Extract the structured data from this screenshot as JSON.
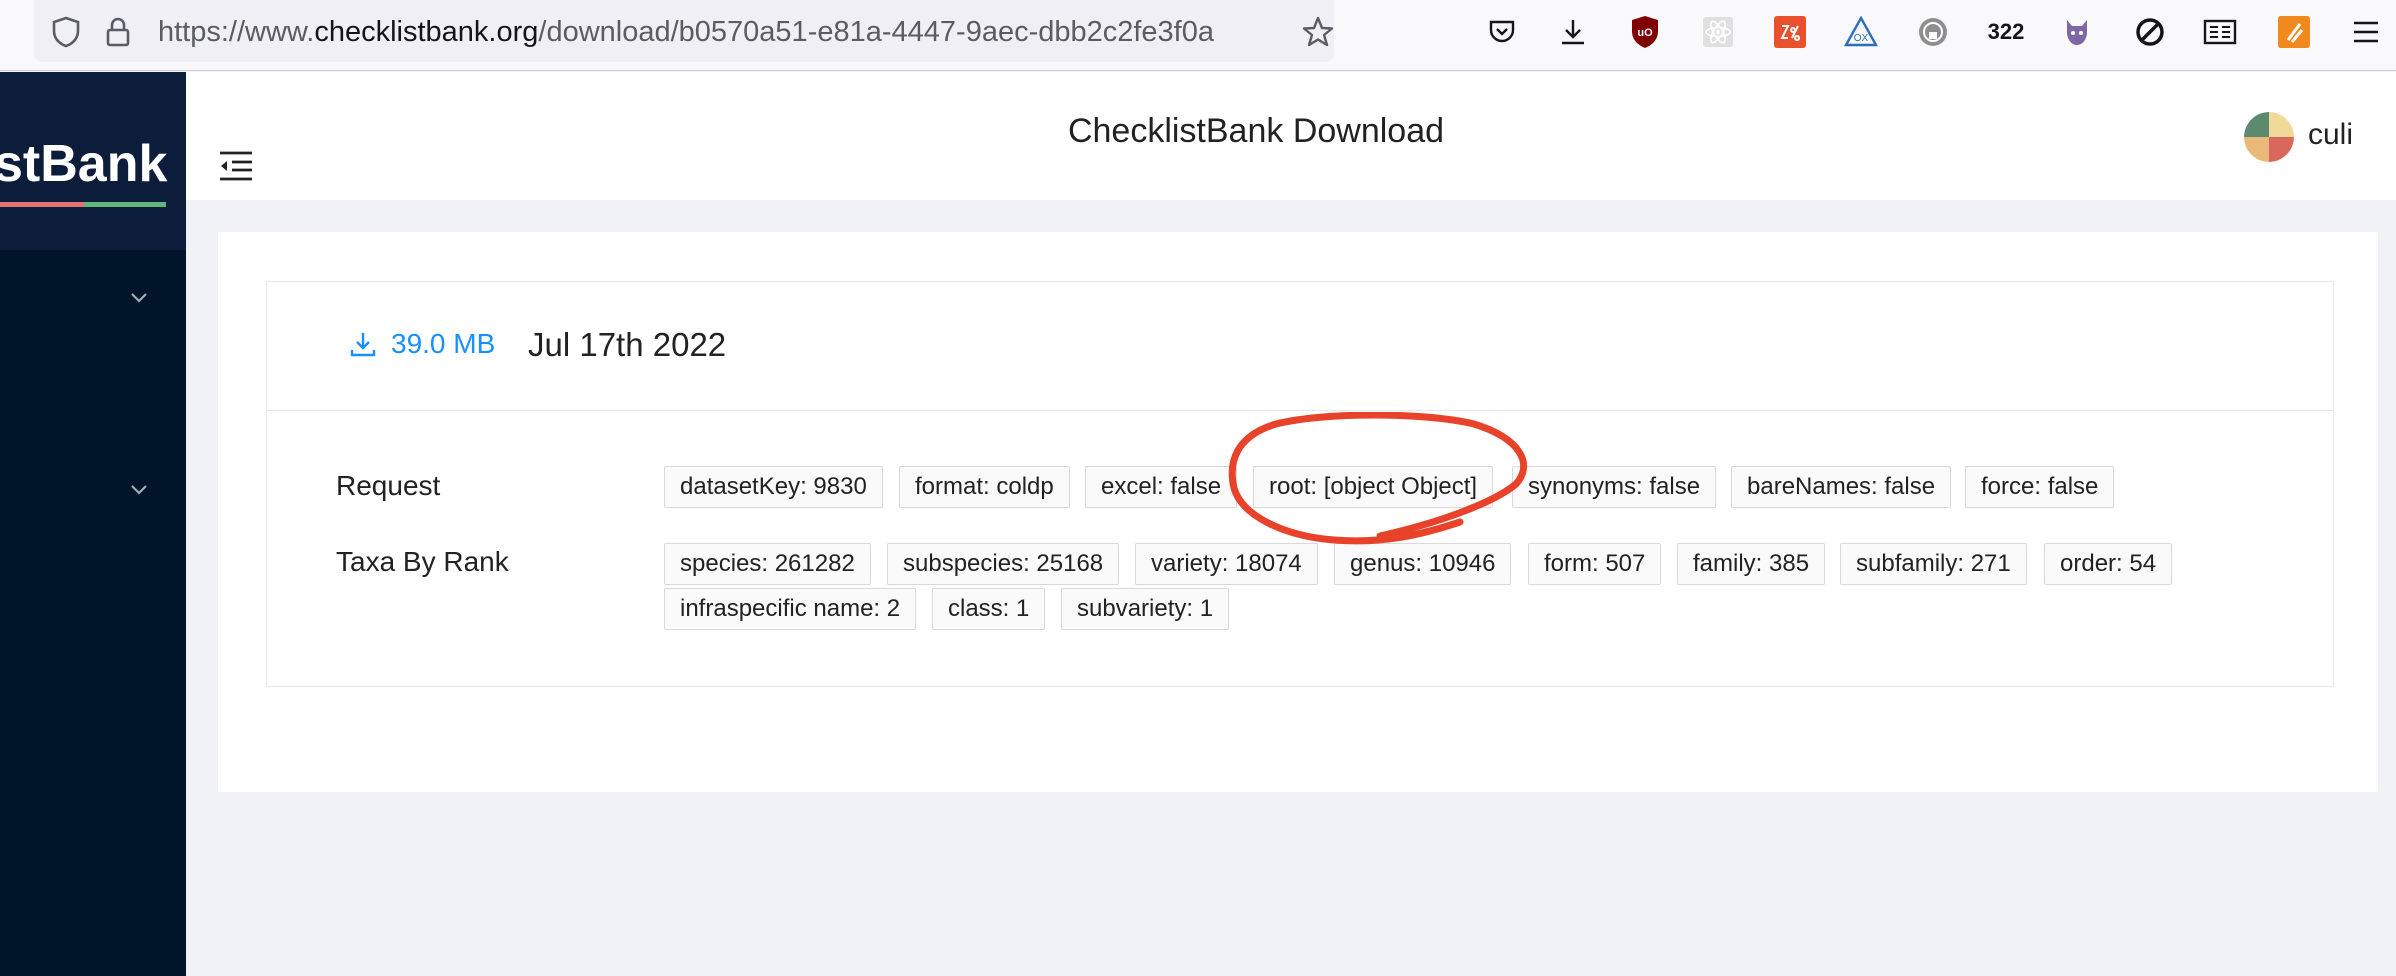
{
  "browser": {
    "url_prefix": "https://www.",
    "url_host": "checklistbank.org",
    "url_path": "/download/b0570a51-e81a-4447-9aec-dbb2c2fe3f0a",
    "extension_badge": "322",
    "icons": [
      "shield-icon",
      "lock-icon",
      "star-icon",
      "pocket-icon",
      "download-icon",
      "ublock-icon",
      "react-icon",
      "zotero-icon",
      "ox-icon",
      "privacy-icon",
      "octocat-icon",
      "block-icon",
      "reader-icon",
      "java-icon",
      "hamburger-icon"
    ]
  },
  "sidebar": {
    "logo_text": "stBank",
    "menu_icons": [
      "chevron-down-icon",
      "chevron-down-icon"
    ]
  },
  "header": {
    "title": "ChecklistBank Download",
    "username": "culi"
  },
  "download": {
    "size": "39.0 MB",
    "date": "Jul 17th 2022"
  },
  "request": {
    "label": "Request",
    "tags": [
      "datasetKey: 9830",
      "format: coldp",
      "excel: false",
      "root: [object Object]",
      "synonyms: false",
      "bareNames: false",
      "force: false"
    ]
  },
  "taxa": {
    "label": "Taxa By Rank",
    "tags": [
      "species: 261282",
      "subspecies: 25168",
      "variety: 18074",
      "genus: 10946",
      "form: 507",
      "family: 385",
      "subfamily: 271",
      "order: 54",
      "infraspecific name: 2",
      "class: 1",
      "subvariety: 1"
    ]
  },
  "colors": {
    "link": "#1890ff",
    "sidebar": "#001529",
    "annotation": "#e8432a"
  }
}
